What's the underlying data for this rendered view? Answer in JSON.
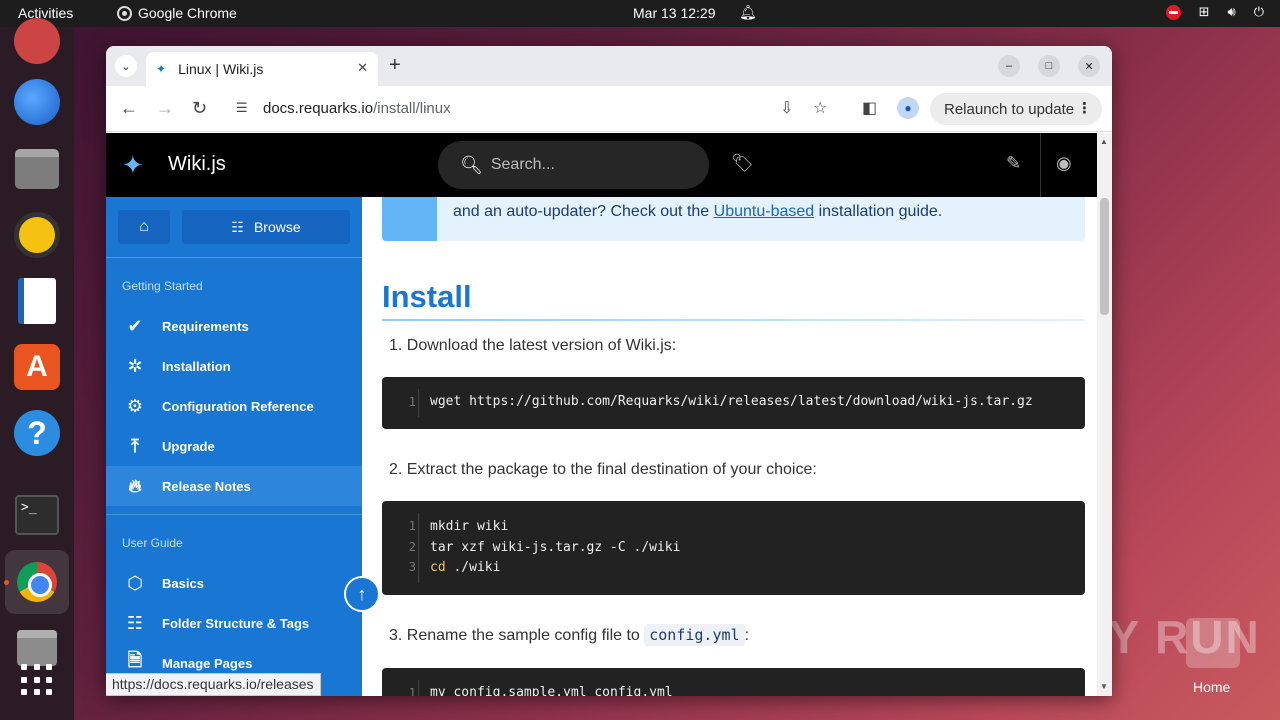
{
  "topbar": {
    "activities": "Activities",
    "app_name": "Google Chrome",
    "clock": "Mar 13  12:29"
  },
  "dock": {
    "items": [
      "firefox",
      "thunderbird",
      "files",
      "rhythmbox",
      "libreoffice-writer",
      "app-center",
      "help",
      "terminal",
      "chrome",
      "disk",
      "show-apps"
    ]
  },
  "desktop": {
    "watermark": "ANY RUN",
    "home_label": "Home"
  },
  "browser": {
    "tab_title": "Linux | Wiki.js",
    "url_host": "docs.requarks.io",
    "url_path": "/install/linux",
    "relaunch_label": "Relaunch to update",
    "status_url": "https://docs.requarks.io/releases"
  },
  "wiki": {
    "brand": "Wiki.js",
    "search_placeholder": "Search...",
    "browse_label": "Browse",
    "sections": [
      {
        "heading": "Getting Started",
        "items": [
          {
            "label": "Requirements",
            "icon": "check-circle-icon"
          },
          {
            "label": "Installation",
            "icon": "sparkle-icon"
          },
          {
            "label": "Configuration Reference",
            "icon": "gear-icon"
          },
          {
            "label": "Upgrade",
            "icon": "upload-icon"
          },
          {
            "label": "Release Notes",
            "icon": "fire-icon"
          }
        ]
      },
      {
        "heading": "User Guide",
        "items": [
          {
            "label": "Basics",
            "icon": "cube-icon"
          },
          {
            "label": "Folder Structure & Tags",
            "icon": "tree-icon"
          },
          {
            "label": "Manage Pages",
            "icon": "page-icon"
          }
        ]
      }
    ],
    "selected_item": "Release Notes"
  },
  "content": {
    "alert_text_before": "and an auto-updater? Check out the ",
    "alert_link": "Ubuntu-based",
    "alert_text_after": " installation guide.",
    "heading": "Install",
    "steps": [
      {
        "text": "1. Download the latest version of Wiki.js:"
      },
      {
        "text": "2. Extract the package to the final destination of your choice:"
      },
      {
        "text_before": "3. Rename the sample config file to ",
        "code": "config.yml",
        "text_after": ":"
      }
    ],
    "code_blocks": [
      {
        "lines": [
          {
            "n": "1",
            "text": "wget https://github.com/Requarks/wiki/releases/latest/download/wiki-js.tar.gz"
          }
        ]
      },
      {
        "lines": [
          {
            "n": "1",
            "text": "mkdir wiki"
          },
          {
            "n": "2",
            "text": "tar xzf wiki-js.tar.gz -C ./wiki"
          },
          {
            "n": "3",
            "kw": "cd",
            "text": " ./wiki"
          }
        ]
      },
      {
        "lines": [
          {
            "n": "1",
            "text": "mv config.sample.yml config.yml"
          }
        ]
      }
    ]
  },
  "colors": {
    "sidebar": "#1976d2",
    "sidebar_selected": "#2d86db",
    "heading": "#1976d2",
    "code_bg": "#222222"
  }
}
